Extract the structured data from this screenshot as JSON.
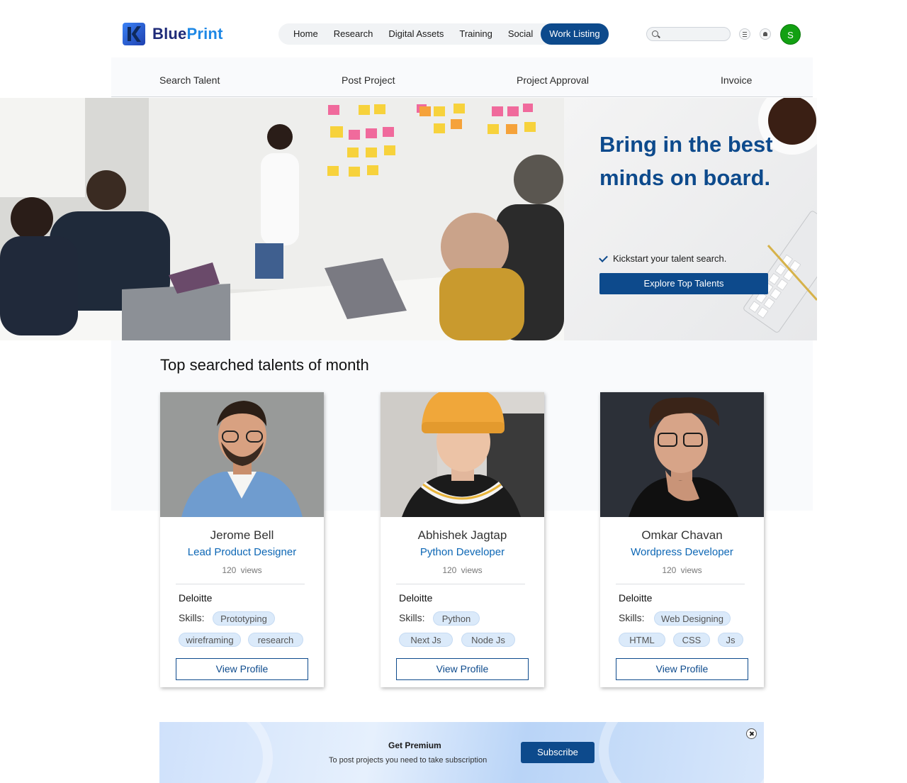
{
  "brand": {
    "name_part1": "Blue",
    "name_part2": "Print",
    "logo_icon": "k-logo-icon"
  },
  "nav": {
    "items": [
      "Home",
      "Research",
      "Digital Assets",
      "Training",
      "Social",
      "Work Listing"
    ],
    "active": "Work Listing"
  },
  "header": {
    "search_placeholder": "",
    "avatar_initial": "S"
  },
  "subnav": {
    "items": [
      "Search Talent",
      "Post Project",
      "Project Approval",
      "Invoice"
    ]
  },
  "hero": {
    "title": "Bring in the best minds on board.",
    "check_text": "Kickstart your talent search.",
    "cta_label": "Explore Top Talents"
  },
  "section": {
    "title": "Top searched talents of month"
  },
  "talents": [
    {
      "name": "Jerome Bell",
      "role": "Lead Product Designer",
      "views": "120 views",
      "company": "Deloitte",
      "skills_label": "Skills:",
      "skills": [
        "Prototyping",
        "wireframing",
        "research"
      ],
      "button": "View Profile"
    },
    {
      "name": "Abhishek Jagtap",
      "role": "Python Developer",
      "views": "120 views",
      "company": "Deloitte",
      "skills_label": "Skills:",
      "skills": [
        "Python",
        "Next Js",
        "Node Js"
      ],
      "button": "View Profile"
    },
    {
      "name": "Omkar Chavan",
      "role": "Wordpress Developer",
      "views": "120 views",
      "company": "Deloitte",
      "skills_label": "Skills:",
      "skills": [
        "Web Designing",
        "HTML",
        "CSS",
        "Js"
      ],
      "button": "View Profile"
    }
  ],
  "premium": {
    "title": "Get Premium",
    "text": "To post projects you need to take subscription",
    "button": "Subscribe"
  },
  "colors": {
    "primary": "#0d4a8c",
    "accent": "#1e88e5",
    "avatar": "#12a012",
    "chip": "#dbeafa"
  }
}
